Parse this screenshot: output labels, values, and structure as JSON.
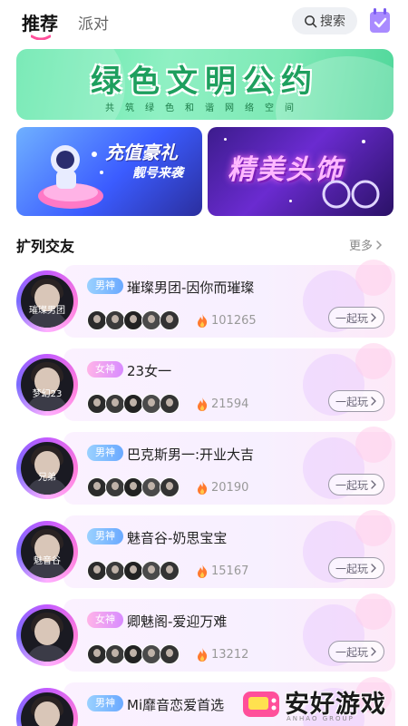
{
  "header": {
    "tabs": [
      {
        "label": "推荐",
        "active": true
      },
      {
        "label": "派对",
        "active": false
      }
    ],
    "search_label": "搜索",
    "checkin_icon": "calendar-check-icon"
  },
  "banner": {
    "title": "绿色文明公约",
    "subtitle": "共筑绿色和谐网络空间"
  },
  "promos": [
    {
      "title": "充值豪礼",
      "subtitle": "靓号来袭"
    },
    {
      "title": "精美头饰"
    }
  ],
  "section": {
    "title": "扩列交友",
    "more_label": "更多"
  },
  "rooms": [
    {
      "badge": "男神",
      "gender": "male",
      "name": "璀璨男团-因你而璀璨",
      "heat": "101265",
      "avatar_text": "璀璨男团",
      "play_label": "一起玩"
    },
    {
      "badge": "女神",
      "gender": "female",
      "name": "23女一",
      "heat": "21594",
      "avatar_text": "梦幻23",
      "play_label": "一起玩"
    },
    {
      "badge": "男神",
      "gender": "male",
      "name": "巴克斯男一:开业大吉",
      "heat": "20190",
      "avatar_text": "兄弟",
      "play_label": "一起玩"
    },
    {
      "badge": "男神",
      "gender": "male",
      "name": "魅音谷-奶思宝宝",
      "heat": "15167",
      "avatar_text": "魅音谷",
      "play_label": "一起玩"
    },
    {
      "badge": "女神",
      "gender": "female",
      "name": "卿魅阁-爱迎万难",
      "heat": "13212",
      "avatar_text": "",
      "play_label": "一起玩"
    },
    {
      "badge": "男神",
      "gender": "male",
      "name": "Mi靡音恋爱首选",
      "heat": "",
      "avatar_text": "",
      "play_label": ""
    }
  ],
  "watermark": {
    "text": "安好游戏",
    "sub": "ANHAO GROUP"
  },
  "colors": {
    "accent_pink": "#ff4f9a",
    "heat_orange": "#ff7a2e",
    "banner_green": "#1e9f5e"
  }
}
